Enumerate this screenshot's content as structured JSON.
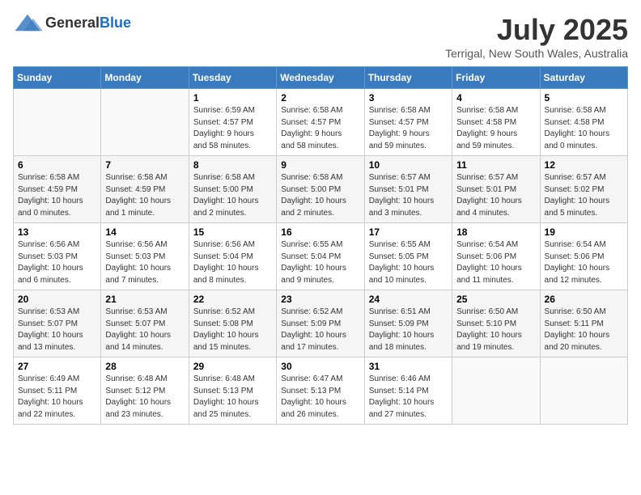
{
  "header": {
    "logo_general": "General",
    "logo_blue": "Blue",
    "month": "July 2025",
    "location": "Terrigal, New South Wales, Australia"
  },
  "days_of_week": [
    "Sunday",
    "Monday",
    "Tuesday",
    "Wednesday",
    "Thursday",
    "Friday",
    "Saturday"
  ],
  "weeks": [
    [
      {
        "day": "",
        "info": ""
      },
      {
        "day": "",
        "info": ""
      },
      {
        "day": "1",
        "info": "Sunrise: 6:59 AM\nSunset: 4:57 PM\nDaylight: 9 hours\nand 58 minutes."
      },
      {
        "day": "2",
        "info": "Sunrise: 6:58 AM\nSunset: 4:57 PM\nDaylight: 9 hours\nand 58 minutes."
      },
      {
        "day": "3",
        "info": "Sunrise: 6:58 AM\nSunset: 4:57 PM\nDaylight: 9 hours\nand 59 minutes."
      },
      {
        "day": "4",
        "info": "Sunrise: 6:58 AM\nSunset: 4:58 PM\nDaylight: 9 hours\nand 59 minutes."
      },
      {
        "day": "5",
        "info": "Sunrise: 6:58 AM\nSunset: 4:58 PM\nDaylight: 10 hours\nand 0 minutes."
      }
    ],
    [
      {
        "day": "6",
        "info": "Sunrise: 6:58 AM\nSunset: 4:59 PM\nDaylight: 10 hours\nand 0 minutes."
      },
      {
        "day": "7",
        "info": "Sunrise: 6:58 AM\nSunset: 4:59 PM\nDaylight: 10 hours\nand 1 minute."
      },
      {
        "day": "8",
        "info": "Sunrise: 6:58 AM\nSunset: 5:00 PM\nDaylight: 10 hours\nand 2 minutes."
      },
      {
        "day": "9",
        "info": "Sunrise: 6:58 AM\nSunset: 5:00 PM\nDaylight: 10 hours\nand 2 minutes."
      },
      {
        "day": "10",
        "info": "Sunrise: 6:57 AM\nSunset: 5:01 PM\nDaylight: 10 hours\nand 3 minutes."
      },
      {
        "day": "11",
        "info": "Sunrise: 6:57 AM\nSunset: 5:01 PM\nDaylight: 10 hours\nand 4 minutes."
      },
      {
        "day": "12",
        "info": "Sunrise: 6:57 AM\nSunset: 5:02 PM\nDaylight: 10 hours\nand 5 minutes."
      }
    ],
    [
      {
        "day": "13",
        "info": "Sunrise: 6:56 AM\nSunset: 5:03 PM\nDaylight: 10 hours\nand 6 minutes."
      },
      {
        "day": "14",
        "info": "Sunrise: 6:56 AM\nSunset: 5:03 PM\nDaylight: 10 hours\nand 7 minutes."
      },
      {
        "day": "15",
        "info": "Sunrise: 6:56 AM\nSunset: 5:04 PM\nDaylight: 10 hours\nand 8 minutes."
      },
      {
        "day": "16",
        "info": "Sunrise: 6:55 AM\nSunset: 5:04 PM\nDaylight: 10 hours\nand 9 minutes."
      },
      {
        "day": "17",
        "info": "Sunrise: 6:55 AM\nSunset: 5:05 PM\nDaylight: 10 hours\nand 10 minutes."
      },
      {
        "day": "18",
        "info": "Sunrise: 6:54 AM\nSunset: 5:06 PM\nDaylight: 10 hours\nand 11 minutes."
      },
      {
        "day": "19",
        "info": "Sunrise: 6:54 AM\nSunset: 5:06 PM\nDaylight: 10 hours\nand 12 minutes."
      }
    ],
    [
      {
        "day": "20",
        "info": "Sunrise: 6:53 AM\nSunset: 5:07 PM\nDaylight: 10 hours\nand 13 minutes."
      },
      {
        "day": "21",
        "info": "Sunrise: 6:53 AM\nSunset: 5:07 PM\nDaylight: 10 hours\nand 14 minutes."
      },
      {
        "day": "22",
        "info": "Sunrise: 6:52 AM\nSunset: 5:08 PM\nDaylight: 10 hours\nand 15 minutes."
      },
      {
        "day": "23",
        "info": "Sunrise: 6:52 AM\nSunset: 5:09 PM\nDaylight: 10 hours\nand 17 minutes."
      },
      {
        "day": "24",
        "info": "Sunrise: 6:51 AM\nSunset: 5:09 PM\nDaylight: 10 hours\nand 18 minutes."
      },
      {
        "day": "25",
        "info": "Sunrise: 6:50 AM\nSunset: 5:10 PM\nDaylight: 10 hours\nand 19 minutes."
      },
      {
        "day": "26",
        "info": "Sunrise: 6:50 AM\nSunset: 5:11 PM\nDaylight: 10 hours\nand 20 minutes."
      }
    ],
    [
      {
        "day": "27",
        "info": "Sunrise: 6:49 AM\nSunset: 5:11 PM\nDaylight: 10 hours\nand 22 minutes."
      },
      {
        "day": "28",
        "info": "Sunrise: 6:48 AM\nSunset: 5:12 PM\nDaylight: 10 hours\nand 23 minutes."
      },
      {
        "day": "29",
        "info": "Sunrise: 6:48 AM\nSunset: 5:13 PM\nDaylight: 10 hours\nand 25 minutes."
      },
      {
        "day": "30",
        "info": "Sunrise: 6:47 AM\nSunset: 5:13 PM\nDaylight: 10 hours\nand 26 minutes."
      },
      {
        "day": "31",
        "info": "Sunrise: 6:46 AM\nSunset: 5:14 PM\nDaylight: 10 hours\nand 27 minutes."
      },
      {
        "day": "",
        "info": ""
      },
      {
        "day": "",
        "info": ""
      }
    ]
  ]
}
